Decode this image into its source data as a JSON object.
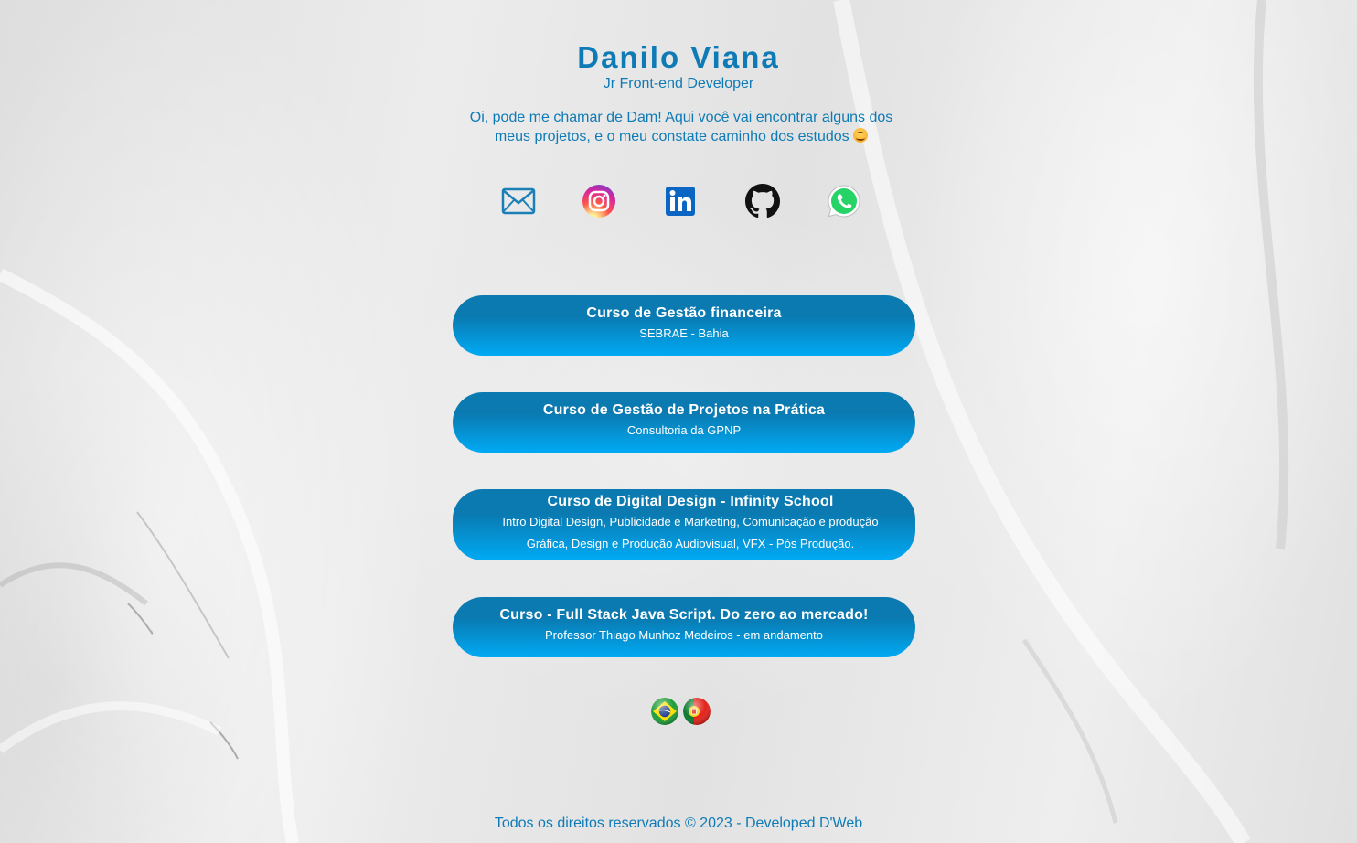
{
  "profile": {
    "name": "Danilo Viana",
    "role": "Jr Front-end Developer",
    "intro": "Oi, pode me chamar de Dam! Aqui você vai encontrar alguns dos meus projetos, e o meu constate caminho dos estudos"
  },
  "socials": [
    {
      "icon": "email-icon",
      "color": "#1b7fb8"
    },
    {
      "icon": "instagram-icon",
      "color": "#d62976"
    },
    {
      "icon": "linkedin-icon",
      "color": "#0a66c2"
    },
    {
      "icon": "github-icon",
      "color": "#111111"
    },
    {
      "icon": "whatsapp-icon",
      "color": "#25d366"
    }
  ],
  "courses": [
    {
      "title": "Curso de Gestão financeira",
      "subtitle": "SEBRAE - Bahia"
    },
    {
      "title": "Curso de Gestão de Projetos na Prática",
      "subtitle": "Consultoria da GPNP"
    },
    {
      "title": "Curso de Digital Design - Infinity School",
      "subtitle": "Intro Digital Design, Publicidade e Marketing, Comunicação e produção Gráfica, Design e Produção Audiovisual, VFX - Pós Produção."
    },
    {
      "title": "Curso - Full Stack Java Script. Do zero ao mercado!",
      "subtitle": "Professor Thiago Munhoz Medeiros - em andamento"
    }
  ],
  "languages": [
    {
      "icon": "brazil-flag-icon"
    },
    {
      "icon": "portugal-flag-icon"
    }
  ],
  "footer": {
    "text": "Todos os direitos reservados © 2023 - Developed D'Web"
  },
  "colors": {
    "accent": "#0e7bb6",
    "button_top": "#0a7ab1",
    "button_bottom": "#00aaf4"
  }
}
